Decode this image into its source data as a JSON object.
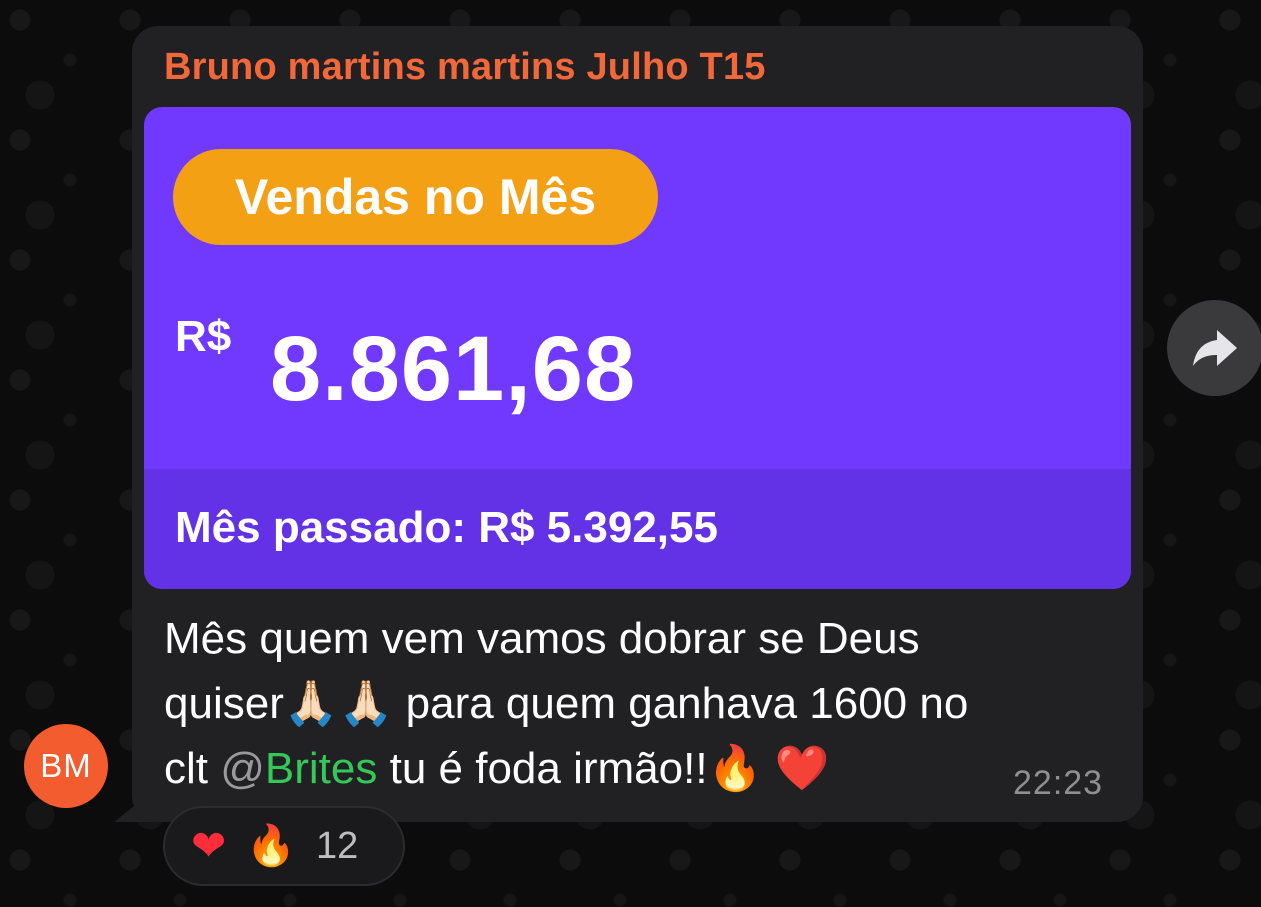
{
  "message": {
    "sender": "Bruno martins martins Julho T15",
    "avatar_initials": "BM",
    "card": {
      "badge": "Vendas no Mês",
      "currency": "R$",
      "amount": "8.861,68",
      "previous_month": "Mês passado: R$ 5.392,55"
    },
    "caption": {
      "line1": "Mês quem vem vamos dobrar se Deus",
      "line2_start": "quiser",
      "pray_emoji": "🙏🏻🙏🏻",
      "line2_end": " para quem ganhava 1600 no",
      "line3_start": "clt ",
      "mention_at": "@",
      "mention_name": "Brites",
      "line3_end": "  tu é foda irmão!!",
      "fire_emoji": "🔥",
      "heart_emoji": "❤️"
    },
    "time": "22:23",
    "reactions": {
      "heart": "❤",
      "fire": "🔥",
      "count": "12"
    }
  },
  "colors": {
    "sender": "#f2683a",
    "card_bg": "#7139fd",
    "card_footer": "#6331e6",
    "badge": "#f3a015",
    "mention": "#34c759",
    "avatar": "#f25c2e"
  },
  "icons": {
    "forward": "forward-arrow-icon"
  }
}
